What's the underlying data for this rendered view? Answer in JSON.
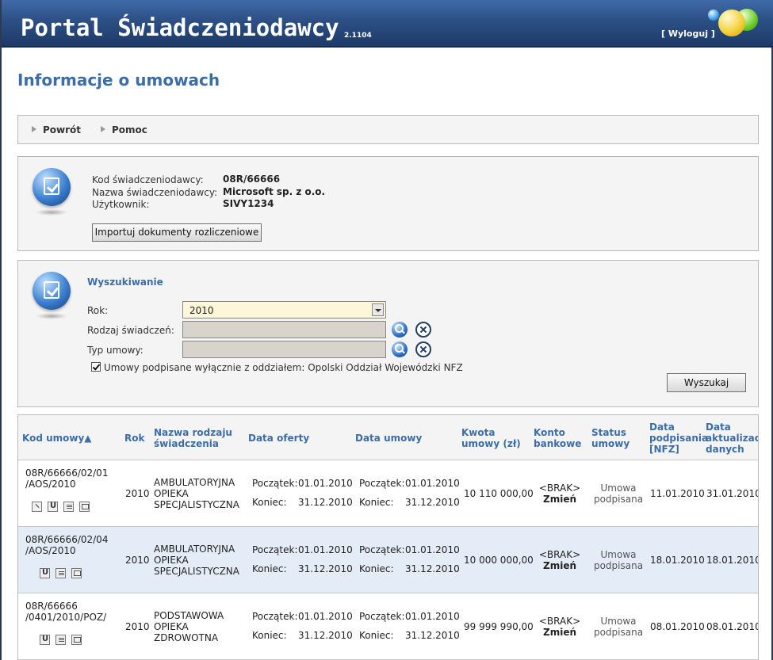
{
  "header": {
    "title": "Portal Świadczeniodawcy",
    "version": "2.1104",
    "logout": "[ Wyloguj ]"
  },
  "page_title": "Informacje o umowach",
  "nav": {
    "back": "Powrót",
    "help": "Pomoc"
  },
  "info": {
    "provider_code_label": "Kod świadczeniodawcy:",
    "provider_code": "08R/66666",
    "provider_name_label": "Nazwa świadczeniodawcy:",
    "provider_name": "Microsoft sp. z o.o.",
    "user_label": "Użytkownik:",
    "user": "SIVY1234",
    "import_button": "Importuj dokumenty rozliczeniowe"
  },
  "search": {
    "title": "Wyszukiwanie",
    "year_label": "Rok:",
    "year_value": "2010",
    "service_type_label": "Rodzaj świadczeń:",
    "service_type_value": "",
    "contract_type_label": "Typ umowy:",
    "contract_type_value": "",
    "checkbox_label": "Umowy podpisane wyłącznie z oddziałem: Opolski Oddział Wojewódzki NFZ",
    "checkbox_checked": true,
    "search_button": "Wyszukaj"
  },
  "table": {
    "headers": {
      "code": "Kod umowy▲",
      "year": "Rok",
      "name_1": "Nazwa rodzaju",
      "name_2": "świadczenia",
      "offer_date": "Data oferty",
      "contract_date": "Data umowy",
      "amount_1": "Kwota",
      "amount_2": "umowy (zł)",
      "account_1": "Konto",
      "account_2": "bankowe",
      "status_1": "Status",
      "status_2": "umowy",
      "signed_1": "Data",
      "signed_2": "podpisania",
      "signed_3": "[NFZ]",
      "updated_1": "Data",
      "updated_2": "aktualizacji",
      "updated_3": "danych"
    },
    "start_label": "Początek:",
    "end_label": "Koniec:",
    "rows": [
      {
        "code_1": "08R/66666/02/01",
        "code_2": "/AOS/2010",
        "year": "2010",
        "name_1": "AMBULATORYJNA",
        "name_2": "OPIEKA",
        "name_3": "SPECJALISTYCZNA",
        "offer_start": "01.01.2010",
        "offer_end": "31.12.2010",
        "contract_start": "01.01.2010",
        "contract_end": "31.12.2010",
        "amount": "10 110 000,00",
        "account": "<BRAK>",
        "account_action": "Zmień",
        "status_1": "Umowa",
        "status_2": "podpisana",
        "signed": "11.01.2010",
        "updated": "31.01.2010"
      },
      {
        "code_1": "08R/66666/02/04",
        "code_2": "/AOS/2010",
        "year": "2010",
        "name_1": "AMBULATORYJNA",
        "name_2": "OPIEKA",
        "name_3": "SPECJALISTYCZNA",
        "offer_start": "01.01.2010",
        "offer_end": "31.12.2010",
        "contract_start": "01.01.2010",
        "contract_end": "31.12.2010",
        "amount": "10 000 000,00",
        "account": "<BRAK>",
        "account_action": "Zmień",
        "status_1": "Umowa",
        "status_2": "podpisana",
        "signed": "18.01.2010",
        "updated": "18.01.2010"
      },
      {
        "code_1": "08R/66666",
        "code_2": "/0401/2010/POZ/",
        "year": "2010",
        "name_1": "PODSTAWOWA",
        "name_2": "OPIEKA",
        "name_3": "ZDROWOTNA",
        "offer_start": "01.01.2010",
        "offer_end": "31.12.2010",
        "contract_start": "01.01.2010",
        "contract_end": "31.12.2010",
        "amount": "99 999 990,00",
        "account": "<BRAK>",
        "account_action": "Zmień",
        "status_1": "Umowa",
        "status_2": "podpisana",
        "signed": "08.01.2010",
        "updated": "08.01.2010"
      }
    ]
  }
}
